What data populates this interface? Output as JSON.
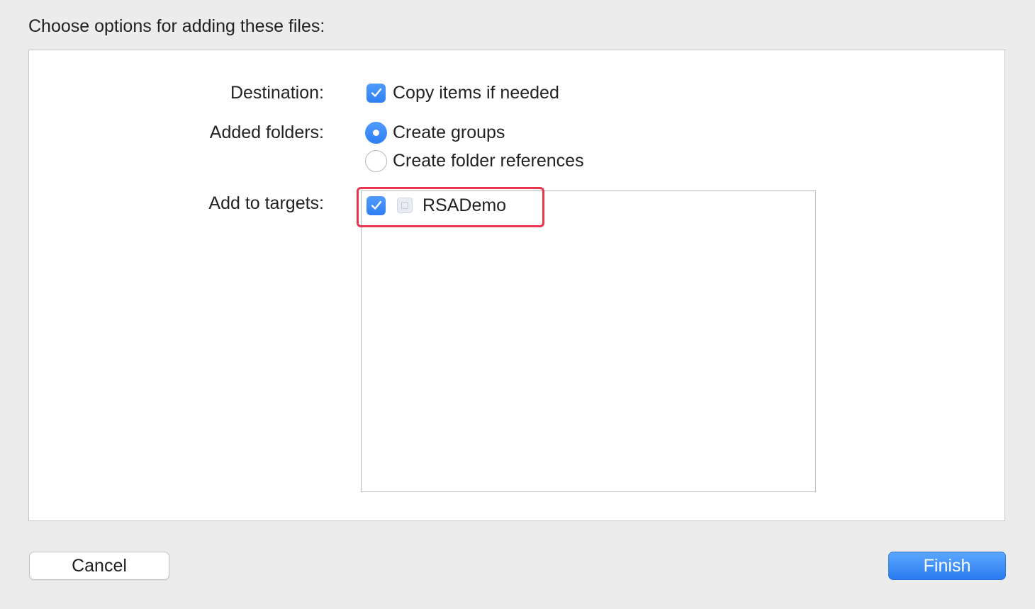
{
  "dialog": {
    "heading": "Choose options for adding these files:"
  },
  "destination": {
    "label": "Destination:",
    "option_label": "Copy items if needed",
    "checked": true
  },
  "added_folders": {
    "label": "Added folders:",
    "options": [
      {
        "label": "Create groups",
        "selected": true
      },
      {
        "label": "Create folder references",
        "selected": false
      }
    ]
  },
  "targets": {
    "label": "Add to targets:",
    "items": [
      {
        "name": "RSADemo",
        "checked": true,
        "icon": "app-target-icon"
      }
    ],
    "highlight_color": "#e8364f"
  },
  "buttons": {
    "cancel_label": "Cancel",
    "finish_label": "Finish"
  },
  "colors": {
    "accent": "#2f7ff3",
    "background": "#ececec"
  }
}
